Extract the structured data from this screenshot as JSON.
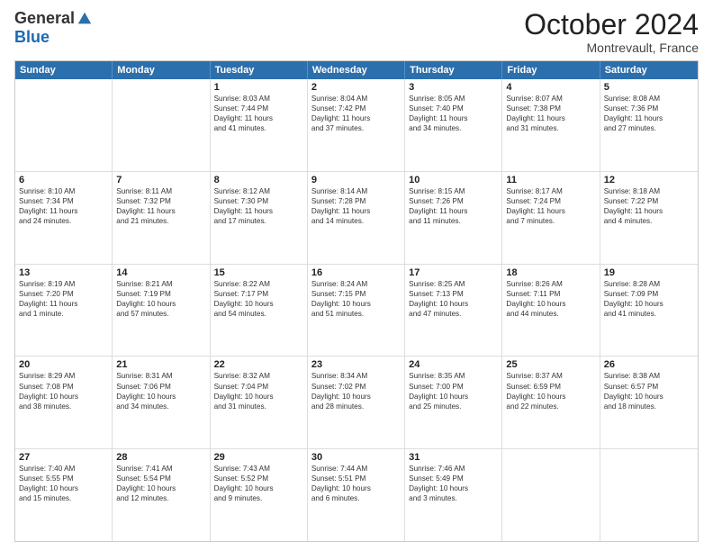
{
  "logo": {
    "general": "General",
    "blue": "Blue"
  },
  "header": {
    "month": "October 2024",
    "location": "Montrevault, France"
  },
  "days": [
    "Sunday",
    "Monday",
    "Tuesday",
    "Wednesday",
    "Thursday",
    "Friday",
    "Saturday"
  ],
  "weeks": [
    [
      {
        "day": "",
        "lines": []
      },
      {
        "day": "",
        "lines": []
      },
      {
        "day": "1",
        "lines": [
          "Sunrise: 8:03 AM",
          "Sunset: 7:44 PM",
          "Daylight: 11 hours",
          "and 41 minutes."
        ]
      },
      {
        "day": "2",
        "lines": [
          "Sunrise: 8:04 AM",
          "Sunset: 7:42 PM",
          "Daylight: 11 hours",
          "and 37 minutes."
        ]
      },
      {
        "day": "3",
        "lines": [
          "Sunrise: 8:05 AM",
          "Sunset: 7:40 PM",
          "Daylight: 11 hours",
          "and 34 minutes."
        ]
      },
      {
        "day": "4",
        "lines": [
          "Sunrise: 8:07 AM",
          "Sunset: 7:38 PM",
          "Daylight: 11 hours",
          "and 31 minutes."
        ]
      },
      {
        "day": "5",
        "lines": [
          "Sunrise: 8:08 AM",
          "Sunset: 7:36 PM",
          "Daylight: 11 hours",
          "and 27 minutes."
        ]
      }
    ],
    [
      {
        "day": "6",
        "lines": [
          "Sunrise: 8:10 AM",
          "Sunset: 7:34 PM",
          "Daylight: 11 hours",
          "and 24 minutes."
        ]
      },
      {
        "day": "7",
        "lines": [
          "Sunrise: 8:11 AM",
          "Sunset: 7:32 PM",
          "Daylight: 11 hours",
          "and 21 minutes."
        ]
      },
      {
        "day": "8",
        "lines": [
          "Sunrise: 8:12 AM",
          "Sunset: 7:30 PM",
          "Daylight: 11 hours",
          "and 17 minutes."
        ]
      },
      {
        "day": "9",
        "lines": [
          "Sunrise: 8:14 AM",
          "Sunset: 7:28 PM",
          "Daylight: 11 hours",
          "and 14 minutes."
        ]
      },
      {
        "day": "10",
        "lines": [
          "Sunrise: 8:15 AM",
          "Sunset: 7:26 PM",
          "Daylight: 11 hours",
          "and 11 minutes."
        ]
      },
      {
        "day": "11",
        "lines": [
          "Sunrise: 8:17 AM",
          "Sunset: 7:24 PM",
          "Daylight: 11 hours",
          "and 7 minutes."
        ]
      },
      {
        "day": "12",
        "lines": [
          "Sunrise: 8:18 AM",
          "Sunset: 7:22 PM",
          "Daylight: 11 hours",
          "and 4 minutes."
        ]
      }
    ],
    [
      {
        "day": "13",
        "lines": [
          "Sunrise: 8:19 AM",
          "Sunset: 7:20 PM",
          "Daylight: 11 hours",
          "and 1 minute."
        ]
      },
      {
        "day": "14",
        "lines": [
          "Sunrise: 8:21 AM",
          "Sunset: 7:19 PM",
          "Daylight: 10 hours",
          "and 57 minutes."
        ]
      },
      {
        "day": "15",
        "lines": [
          "Sunrise: 8:22 AM",
          "Sunset: 7:17 PM",
          "Daylight: 10 hours",
          "and 54 minutes."
        ]
      },
      {
        "day": "16",
        "lines": [
          "Sunrise: 8:24 AM",
          "Sunset: 7:15 PM",
          "Daylight: 10 hours",
          "and 51 minutes."
        ]
      },
      {
        "day": "17",
        "lines": [
          "Sunrise: 8:25 AM",
          "Sunset: 7:13 PM",
          "Daylight: 10 hours",
          "and 47 minutes."
        ]
      },
      {
        "day": "18",
        "lines": [
          "Sunrise: 8:26 AM",
          "Sunset: 7:11 PM",
          "Daylight: 10 hours",
          "and 44 minutes."
        ]
      },
      {
        "day": "19",
        "lines": [
          "Sunrise: 8:28 AM",
          "Sunset: 7:09 PM",
          "Daylight: 10 hours",
          "and 41 minutes."
        ]
      }
    ],
    [
      {
        "day": "20",
        "lines": [
          "Sunrise: 8:29 AM",
          "Sunset: 7:08 PM",
          "Daylight: 10 hours",
          "and 38 minutes."
        ]
      },
      {
        "day": "21",
        "lines": [
          "Sunrise: 8:31 AM",
          "Sunset: 7:06 PM",
          "Daylight: 10 hours",
          "and 34 minutes."
        ]
      },
      {
        "day": "22",
        "lines": [
          "Sunrise: 8:32 AM",
          "Sunset: 7:04 PM",
          "Daylight: 10 hours",
          "and 31 minutes."
        ]
      },
      {
        "day": "23",
        "lines": [
          "Sunrise: 8:34 AM",
          "Sunset: 7:02 PM",
          "Daylight: 10 hours",
          "and 28 minutes."
        ]
      },
      {
        "day": "24",
        "lines": [
          "Sunrise: 8:35 AM",
          "Sunset: 7:00 PM",
          "Daylight: 10 hours",
          "and 25 minutes."
        ]
      },
      {
        "day": "25",
        "lines": [
          "Sunrise: 8:37 AM",
          "Sunset: 6:59 PM",
          "Daylight: 10 hours",
          "and 22 minutes."
        ]
      },
      {
        "day": "26",
        "lines": [
          "Sunrise: 8:38 AM",
          "Sunset: 6:57 PM",
          "Daylight: 10 hours",
          "and 18 minutes."
        ]
      }
    ],
    [
      {
        "day": "27",
        "lines": [
          "Sunrise: 7:40 AM",
          "Sunset: 5:55 PM",
          "Daylight: 10 hours",
          "and 15 minutes."
        ]
      },
      {
        "day": "28",
        "lines": [
          "Sunrise: 7:41 AM",
          "Sunset: 5:54 PM",
          "Daylight: 10 hours",
          "and 12 minutes."
        ]
      },
      {
        "day": "29",
        "lines": [
          "Sunrise: 7:43 AM",
          "Sunset: 5:52 PM",
          "Daylight: 10 hours",
          "and 9 minutes."
        ]
      },
      {
        "day": "30",
        "lines": [
          "Sunrise: 7:44 AM",
          "Sunset: 5:51 PM",
          "Daylight: 10 hours",
          "and 6 minutes."
        ]
      },
      {
        "day": "31",
        "lines": [
          "Sunrise: 7:46 AM",
          "Sunset: 5:49 PM",
          "Daylight: 10 hours",
          "and 3 minutes."
        ]
      },
      {
        "day": "",
        "lines": []
      },
      {
        "day": "",
        "lines": []
      }
    ]
  ]
}
